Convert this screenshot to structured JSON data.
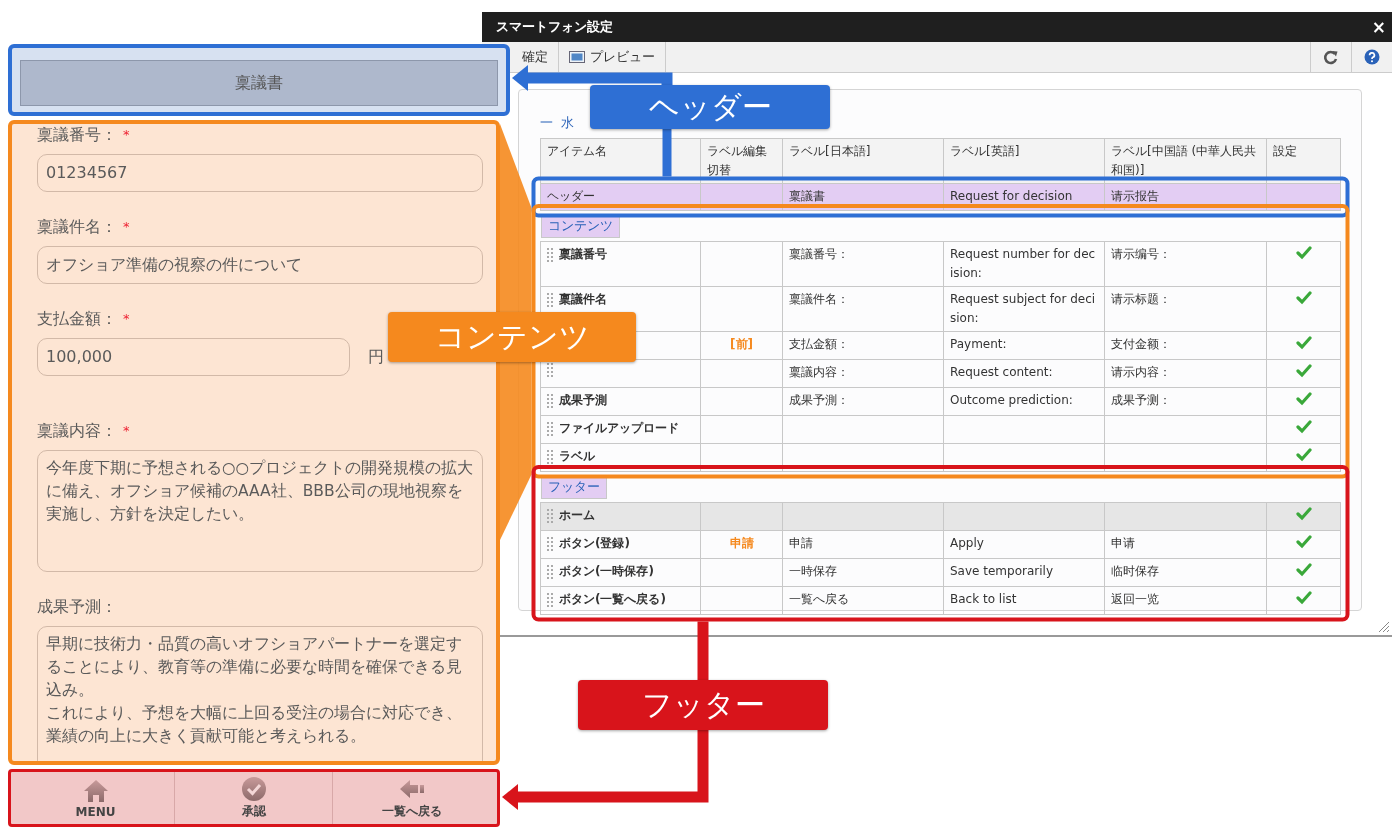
{
  "phone_preview": {
    "header_title": "稟議書",
    "fields": [
      {
        "kind": "text",
        "label": "稟議番号：",
        "required_mark": "*",
        "value": "01234567"
      },
      {
        "kind": "text",
        "label": "稟議件名：",
        "required_mark": "*",
        "value": "オフショア準備の視察の件について"
      },
      {
        "kind": "amount",
        "label": "支払金額：",
        "required_mark": "*",
        "value": "100,000",
        "unit": "円"
      },
      {
        "kind": "textarea",
        "label": "稟議内容：",
        "required_mark": "*",
        "value": "今年度下期に予想される○○プロジェクトの開発規模の拡大に備え、オフショア候補のAAA社、BBB公司の現地視察を実施し、方針を決定したい。"
      },
      {
        "kind": "textarea",
        "label": "成果予測：",
        "paragraphs": [
          "早期に技術力・品質の高いオフショアパートナーを選定することにより、教育等の準備に必要な時間を確保できる見込み。",
          "これにより、予想を大幅に上回る受注の場合に対応でき、業績の向上に大きく貢献可能と考えられる。"
        ]
      }
    ],
    "footer_buttons": [
      {
        "label": "MENU"
      },
      {
        "label": "承認"
      },
      {
        "label": "一覧へ戻る"
      }
    ]
  },
  "window": {
    "title": "スマートフォン設定",
    "close": "×",
    "toolbar": [
      {
        "label": "確定"
      },
      {
        "label": "プレビュー"
      }
    ],
    "section": {
      "toggle": "一",
      "title": "水"
    },
    "table": {
      "columns": [
        "アイテム名",
        "ラベル編集切替",
        "ラベル[日本語]",
        "ラベル[英語]",
        "ラベル[中国語 (中華人民共和国)]",
        "設定"
      ],
      "rows": [
        {
          "kind": "header",
          "name": "ヘッダー",
          "ja": "稟議書",
          "en": "Request for decision",
          "zh": "请示报告",
          "enabled": false
        },
        {
          "kind": "section",
          "title": "コンテンツ"
        },
        {
          "kind": "item",
          "name": "稟議番号",
          "ja": "稟議番号：",
          "en": "Request number for decision:",
          "zh": "请示编号：",
          "enabled": true
        },
        {
          "kind": "item",
          "name": "稟議件名",
          "ja": "稟議件名：",
          "en": "Request subject for decision:",
          "zh": "请示标题：",
          "enabled": true
        },
        {
          "kind": "item",
          "toggle": "[前]",
          "ja": "支払金額：",
          "en": "Payment:",
          "zh": "支付金额：",
          "enabled": true
        },
        {
          "kind": "item",
          "ja": "稟議内容：",
          "en": "Request content:",
          "zh": "请示内容：",
          "enabled": true
        },
        {
          "kind": "item",
          "name": "成果予測",
          "ja": "成果予測：",
          "en": "Outcome prediction:",
          "zh": "成果予测：",
          "enabled": true
        },
        {
          "kind": "item",
          "name": "ファイルアップロード",
          "enabled": true
        },
        {
          "kind": "item",
          "name": "ラベル",
          "enabled": true
        },
        {
          "kind": "section",
          "title": "フッター"
        },
        {
          "kind": "fixed",
          "name": "ホーム",
          "enabled": true
        },
        {
          "kind": "item",
          "name": "ボタン(登録)",
          "toggle": "申請",
          "ja": "申請",
          "en": "Apply",
          "zh": "申请",
          "enabled": true
        },
        {
          "kind": "item",
          "name": "ボタン(一時保存)",
          "ja": "一時保存",
          "en": "Save temporarily",
          "zh": "临时保存",
          "enabled": true
        },
        {
          "kind": "item",
          "name": "ボタン(一覧へ戻る)",
          "ja": "一覧へ戻る",
          "en": "Back to list",
          "zh": "返回一览",
          "enabled": true
        }
      ]
    }
  },
  "annotations": [
    {
      "kind": "header",
      "label": "ヘッダー",
      "color": "#2e6fd4"
    },
    {
      "kind": "contents",
      "label": "コンテンツ",
      "color": "#f5891e"
    },
    {
      "kind": "footer",
      "label": "フッター",
      "color": "#d8141b"
    }
  ]
}
